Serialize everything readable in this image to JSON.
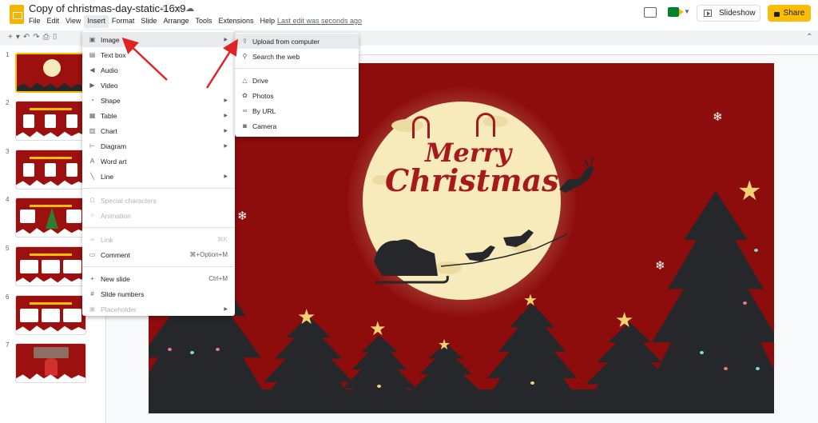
{
  "document": {
    "title": "Copy of christmas-day-static-16x9",
    "last_edit": "Last edit was seconds ago"
  },
  "menubar": {
    "items": [
      "File",
      "Edit",
      "View",
      "Insert",
      "Format",
      "Slide",
      "Arrange",
      "Tools",
      "Extensions",
      "Help"
    ],
    "active": "Insert"
  },
  "header": {
    "slideshow_label": "Slideshow",
    "share_label": "Share"
  },
  "filmstrip": {
    "slide_numbers": [
      "1",
      "2",
      "3",
      "4",
      "5",
      "6",
      "7"
    ],
    "selected": "1"
  },
  "insert_menu": {
    "items": [
      {
        "label": "Image",
        "icon": "image-icon",
        "arrow": true,
        "active": true
      },
      {
        "label": "Text box",
        "icon": "text-box-icon"
      },
      {
        "label": "Audio",
        "icon": "audio-icon"
      },
      {
        "label": "Video",
        "icon": "video-icon"
      },
      {
        "label": "Shape",
        "icon": "shape-icon",
        "arrow": true
      },
      {
        "label": "Table",
        "icon": "table-icon",
        "arrow": true
      },
      {
        "label": "Chart",
        "icon": "chart-icon",
        "arrow": true
      },
      {
        "label": "Diagram",
        "icon": "diagram-icon",
        "arrow": true
      },
      {
        "label": "Word art",
        "icon": "word-art-icon"
      },
      {
        "label": "Line",
        "icon": "line-icon",
        "arrow": true
      },
      {
        "label": "Special characters",
        "icon": "omega-icon",
        "disabled": true
      },
      {
        "label": "Animation",
        "icon": "animation-icon",
        "disabled": true
      },
      {
        "label": "Link",
        "icon": "link-icon",
        "disabled": true,
        "shortcut": "⌘K"
      },
      {
        "label": "Comment",
        "icon": "comment-icon",
        "shortcut": "⌘+Option+M"
      },
      {
        "label": "New slide",
        "icon": "plus-icon",
        "shortcut": "Ctrl+M"
      },
      {
        "label": "Slide numbers",
        "icon": "hash-icon"
      },
      {
        "label": "Placeholder",
        "icon": "placeholder-icon",
        "arrow": true,
        "disabled": true
      }
    ]
  },
  "image_submenu": {
    "items": [
      {
        "label": "Upload from computer",
        "icon": "upload-icon",
        "active": true
      },
      {
        "label": "Search the web",
        "icon": "search-icon"
      },
      {
        "label": "Drive",
        "icon": "drive-icon"
      },
      {
        "label": "Photos",
        "icon": "photos-icon"
      },
      {
        "label": "By URL",
        "icon": "link-icon"
      },
      {
        "label": "Camera",
        "icon": "camera-icon"
      }
    ]
  },
  "slide": {
    "line1": "Merry",
    "line2": "Christmas"
  },
  "colors": {
    "accent": "#fbbc04",
    "slide_bg": "#8d0d0d",
    "tree": "#25272a",
    "moon": "#f7ebbb",
    "annotation_arrow": "#e02424"
  }
}
